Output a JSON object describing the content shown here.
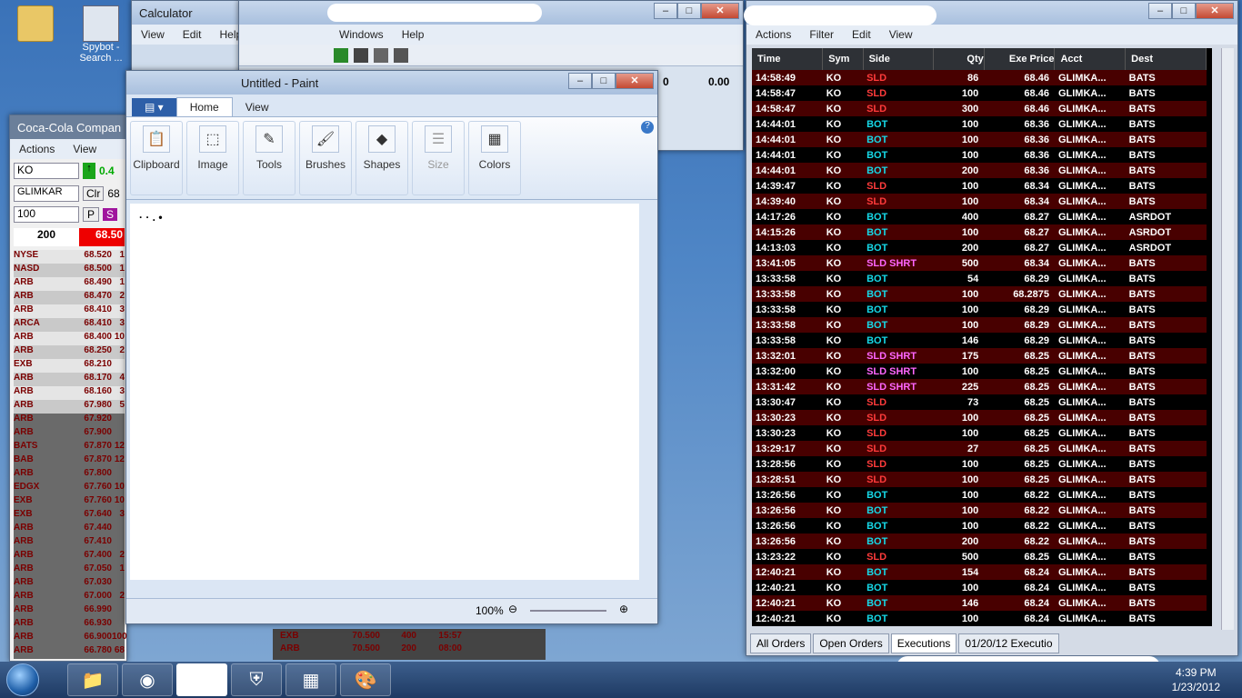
{
  "desktop": {
    "icons": [
      {
        "label": ""
      },
      {
        "label": "Spybot - Search ..."
      }
    ]
  },
  "calculator": {
    "title": "Calculator",
    "menu": [
      "View",
      "Edit",
      "Help"
    ]
  },
  "bgwin": {
    "menu": [
      "Windows",
      "Help"
    ],
    "vals": [
      "0",
      "0.00"
    ]
  },
  "level2": {
    "title": "Coca-Cola Compan",
    "menu": [
      "Actions",
      "View"
    ],
    "symbol": "KO",
    "change": "0.4",
    "account": "GLIMKAR",
    "clr": "Clr",
    "price2": "68",
    "qty": "100",
    "p": "P",
    "s": "S",
    "size": "200",
    "last": "68.50",
    "book": [
      [
        "NYSE",
        "68.520",
        "1"
      ],
      [
        "NASD",
        "68.500",
        "1"
      ],
      [
        "ARB",
        "68.490",
        "1"
      ],
      [
        "ARB",
        "68.470",
        "2"
      ],
      [
        "ARB",
        "68.410",
        "3"
      ],
      [
        "ARCA",
        "68.410",
        "3"
      ],
      [
        "ARB",
        "68.400",
        "10"
      ],
      [
        "ARB",
        "68.250",
        "2"
      ],
      [
        "EXB",
        "68.210",
        ""
      ],
      [
        "ARB",
        "68.170",
        "4"
      ],
      [
        "ARB",
        "68.160",
        "3"
      ],
      [
        "ARB",
        "67.980",
        "5"
      ],
      [
        "ARB",
        "67.920",
        ""
      ],
      [
        "ARB",
        "67.900",
        ""
      ],
      [
        "BATS",
        "67.870",
        "12"
      ],
      [
        "BAB",
        "67.870",
        "12"
      ],
      [
        "ARB",
        "67.800",
        ""
      ],
      [
        "EDGX",
        "67.760",
        "10"
      ],
      [
        "EXB",
        "67.760",
        "10"
      ],
      [
        "EXB",
        "67.640",
        "3"
      ],
      [
        "ARB",
        "67.440",
        ""
      ],
      [
        "ARB",
        "67.410",
        ""
      ],
      [
        "ARB",
        "67.400",
        "2"
      ],
      [
        "ARB",
        "67.050",
        "1"
      ],
      [
        "ARB",
        "67.030",
        ""
      ],
      [
        "ARB",
        "67.000",
        "2"
      ],
      [
        "ARB",
        "66.990",
        ""
      ],
      [
        "ARB",
        "66.930",
        ""
      ],
      [
        "ARB",
        "66.900",
        "100"
      ],
      [
        "ARB",
        "66.780",
        "68"
      ]
    ],
    "times": [
      "08:00",
      "08:00"
    ],
    "bottomrows": [
      [
        "EXB",
        "70.500",
        "400",
        "15:57"
      ],
      [
        "ARB",
        "70.500",
        "200",
        "08:00"
      ]
    ]
  },
  "paint": {
    "title": "Untitled - Paint",
    "tabs": [
      "Home",
      "View"
    ],
    "groups": [
      "Clipboard",
      "Image",
      "Tools",
      "Brushes",
      "Shapes",
      "Size",
      "Colors"
    ],
    "zoom": "100%"
  },
  "executions": {
    "menu": [
      "Actions",
      "Filter",
      "Edit",
      "View"
    ],
    "headers": [
      "Time",
      "Sym",
      "Side",
      "Qty",
      "Exe Price",
      "Acct",
      "Dest"
    ],
    "rows": [
      [
        "14:58:49",
        "KO",
        "SLD",
        "86",
        "68.46",
        "GLIMKA...",
        "BATS"
      ],
      [
        "14:58:47",
        "KO",
        "SLD",
        "100",
        "68.46",
        "GLIMKA...",
        "BATS"
      ],
      [
        "14:58:47",
        "KO",
        "SLD",
        "300",
        "68.46",
        "GLIMKA...",
        "BATS"
      ],
      [
        "14:44:01",
        "KO",
        "BOT",
        "100",
        "68.36",
        "GLIMKA...",
        "BATS"
      ],
      [
        "14:44:01",
        "KO",
        "BOT",
        "100",
        "68.36",
        "GLIMKA...",
        "BATS"
      ],
      [
        "14:44:01",
        "KO",
        "BOT",
        "100",
        "68.36",
        "GLIMKA...",
        "BATS"
      ],
      [
        "14:44:01",
        "KO",
        "BOT",
        "200",
        "68.36",
        "GLIMKA...",
        "BATS"
      ],
      [
        "14:39:47",
        "KO",
        "SLD",
        "100",
        "68.34",
        "GLIMKA...",
        "BATS"
      ],
      [
        "14:39:40",
        "KO",
        "SLD",
        "100",
        "68.34",
        "GLIMKA...",
        "BATS"
      ],
      [
        "14:17:26",
        "KO",
        "BOT",
        "400",
        "68.27",
        "GLIMKA...",
        "ASRDOT"
      ],
      [
        "14:15:26",
        "KO",
        "BOT",
        "100",
        "68.27",
        "GLIMKA...",
        "ASRDOT"
      ],
      [
        "14:13:03",
        "KO",
        "BOT",
        "200",
        "68.27",
        "GLIMKA...",
        "ASRDOT"
      ],
      [
        "13:41:05",
        "KO",
        "SLD SHRT",
        "500",
        "68.34",
        "GLIMKA...",
        "BATS"
      ],
      [
        "13:33:58",
        "KO",
        "BOT",
        "54",
        "68.29",
        "GLIMKA...",
        "BATS"
      ],
      [
        "13:33:58",
        "KO",
        "BOT",
        "100",
        "68.2875",
        "GLIMKA...",
        "BATS"
      ],
      [
        "13:33:58",
        "KO",
        "BOT",
        "100",
        "68.29",
        "GLIMKA...",
        "BATS"
      ],
      [
        "13:33:58",
        "KO",
        "BOT",
        "100",
        "68.29",
        "GLIMKA...",
        "BATS"
      ],
      [
        "13:33:58",
        "KO",
        "BOT",
        "146",
        "68.29",
        "GLIMKA...",
        "BATS"
      ],
      [
        "13:32:01",
        "KO",
        "SLD SHRT",
        "175",
        "68.25",
        "GLIMKA...",
        "BATS"
      ],
      [
        "13:32:00",
        "KO",
        "SLD SHRT",
        "100",
        "68.25",
        "GLIMKA...",
        "BATS"
      ],
      [
        "13:31:42",
        "KO",
        "SLD SHRT",
        "225",
        "68.25",
        "GLIMKA...",
        "BATS"
      ],
      [
        "13:30:47",
        "KO",
        "SLD",
        "73",
        "68.25",
        "GLIMKA...",
        "BATS"
      ],
      [
        "13:30:23",
        "KO",
        "SLD",
        "100",
        "68.25",
        "GLIMKA...",
        "BATS"
      ],
      [
        "13:30:23",
        "KO",
        "SLD",
        "100",
        "68.25",
        "GLIMKA...",
        "BATS"
      ],
      [
        "13:29:17",
        "KO",
        "SLD",
        "27",
        "68.25",
        "GLIMKA...",
        "BATS"
      ],
      [
        "13:28:56",
        "KO",
        "SLD",
        "100",
        "68.25",
        "GLIMKA...",
        "BATS"
      ],
      [
        "13:28:51",
        "KO",
        "SLD",
        "100",
        "68.25",
        "GLIMKA...",
        "BATS"
      ],
      [
        "13:26:56",
        "KO",
        "BOT",
        "100",
        "68.22",
        "GLIMKA...",
        "BATS"
      ],
      [
        "13:26:56",
        "KO",
        "BOT",
        "100",
        "68.22",
        "GLIMKA...",
        "BATS"
      ],
      [
        "13:26:56",
        "KO",
        "BOT",
        "100",
        "68.22",
        "GLIMKA...",
        "BATS"
      ],
      [
        "13:26:56",
        "KO",
        "BOT",
        "200",
        "68.22",
        "GLIMKA...",
        "BATS"
      ],
      [
        "13:23:22",
        "KO",
        "SLD",
        "500",
        "68.25",
        "GLIMKA...",
        "BATS"
      ],
      [
        "12:40:21",
        "KO",
        "BOT",
        "154",
        "68.24",
        "GLIMKA...",
        "BATS"
      ],
      [
        "12:40:21",
        "KO",
        "BOT",
        "100",
        "68.24",
        "GLIMKA...",
        "BATS"
      ],
      [
        "12:40:21",
        "KO",
        "BOT",
        "146",
        "68.24",
        "GLIMKA...",
        "BATS"
      ],
      [
        "12:40:21",
        "KO",
        "BOT",
        "100",
        "68.24",
        "GLIMKA...",
        "BATS"
      ]
    ],
    "tabs": [
      "All Orders",
      "Open Orders",
      "Executions",
      "01/20/12 Executio"
    ]
  },
  "taskbar": {
    "time": "4:39 PM",
    "date": "1/23/2012"
  }
}
